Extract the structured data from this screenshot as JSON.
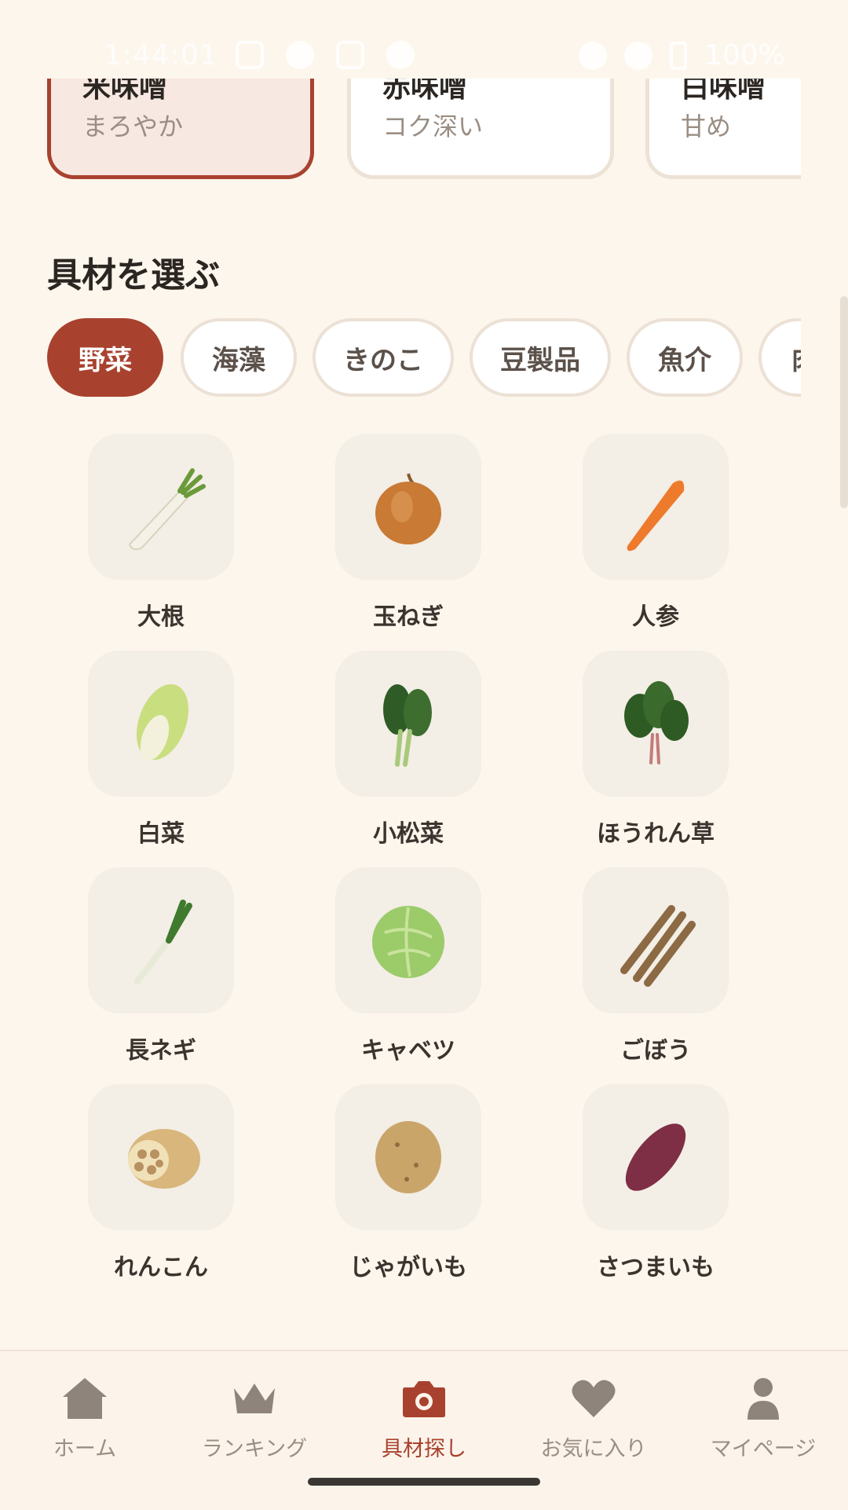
{
  "status_bar": {
    "time": "1:44:01",
    "battery": "100%"
  },
  "miso_types": [
    {
      "name": "米味噌",
      "desc": "まろやか",
      "selected": true
    },
    {
      "name": "赤味噌",
      "desc": "コク深い",
      "selected": false
    },
    {
      "name": "白味噌",
      "desc": "甘め",
      "selected": false
    }
  ],
  "section_title": "具材を選ぶ",
  "categories": [
    "野菜",
    "海藻",
    "きのこ",
    "豆製品",
    "魚介",
    "肉"
  ],
  "active_category": "野菜",
  "ingredients": [
    {
      "label": "大根",
      "icon": "daikon-icon"
    },
    {
      "label": "玉ねぎ",
      "icon": "onion-icon"
    },
    {
      "label": "人参",
      "icon": "carrot-icon"
    },
    {
      "label": "白菜",
      "icon": "napa-cabbage-icon"
    },
    {
      "label": "小松菜",
      "icon": "komatsuna-icon"
    },
    {
      "label": "ほうれん草",
      "icon": "spinach-icon"
    },
    {
      "label": "長ネギ",
      "icon": "green-onion-icon"
    },
    {
      "label": "キャベツ",
      "icon": "cabbage-icon"
    },
    {
      "label": "ごぼう",
      "icon": "burdock-icon"
    },
    {
      "label": "れんこん",
      "icon": "lotus-root-icon"
    },
    {
      "label": "じゃがいも",
      "icon": "potato-icon"
    },
    {
      "label": "さつまいも",
      "icon": "sweet-potato-icon"
    }
  ],
  "bottom_nav": [
    {
      "label": "ホーム",
      "icon": "home-icon",
      "active": false
    },
    {
      "label": "ランキング",
      "icon": "crown-icon",
      "active": false
    },
    {
      "label": "具材探し",
      "icon": "camera-icon",
      "active": true
    },
    {
      "label": "お気に入り",
      "icon": "heart-icon",
      "active": false
    },
    {
      "label": "マイページ",
      "icon": "person-icon",
      "active": false
    }
  ],
  "colors": {
    "accent": "#A8422F",
    "background": "#FDF6EC",
    "muted": "#9A8E84"
  }
}
